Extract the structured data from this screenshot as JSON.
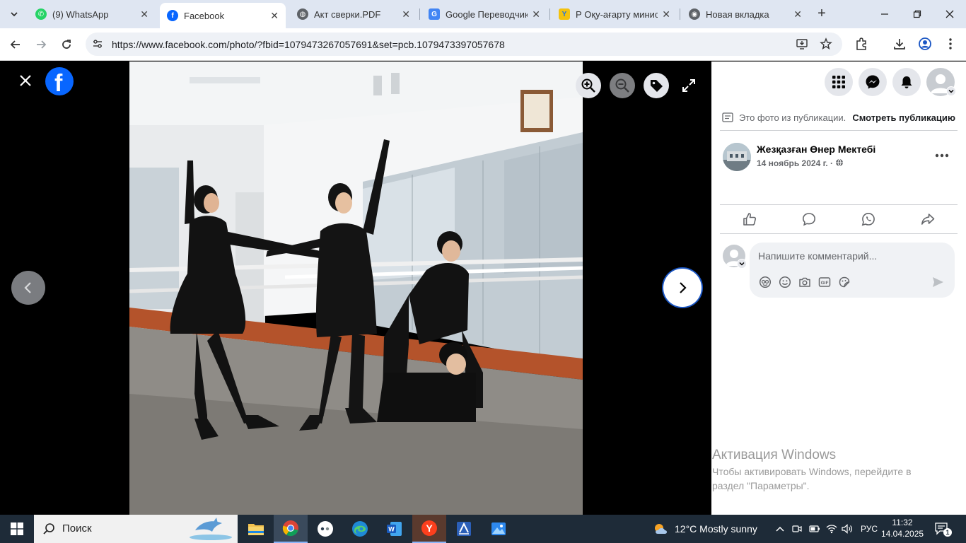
{
  "browser": {
    "tabs": [
      {
        "title": "(9) WhatsApp",
        "favicon": "whatsapp-icon",
        "color": "#25d366"
      },
      {
        "title": "Facebook",
        "favicon": "facebook-icon",
        "color": "#0866ff"
      },
      {
        "title": "Акт сверки.PDF",
        "favicon": "globe-icon",
        "color": "#5f6368"
      },
      {
        "title": "Google Переводчик",
        "favicon": "translate-icon",
        "color": "#4285f4"
      },
      {
        "title": "Р Оқу-ағарту минис",
        "favicon": "ministry-icon",
        "color": "#1a73e8"
      },
      {
        "title": "Новая вкладка",
        "favicon": "chrome-icon",
        "color": "#5f6368"
      }
    ],
    "url": "https://www.facebook.com/photo/?fbid=1079473267057691&set=pcb.1079473397057678"
  },
  "panel": {
    "from_post_text": "Это фото из публикации.",
    "view_post_label": "Смотреть публикацию",
    "author_name": "Жезқазған Өнер Мектебі",
    "post_date": "14 ноябрь 2024 г. ·",
    "comment_placeholder": "Напишите комментарий..."
  },
  "activation": {
    "title": "Активация Windows",
    "message": "Чтобы активировать Windows, перейдите в раздел \"Параметры\"."
  },
  "taskbar": {
    "search_label": "Поиск",
    "weather": "12°C  Mostly sunny",
    "language": "РУС",
    "time": "11:32",
    "date": "14.04.2025",
    "notification_count": "1"
  },
  "colors": {
    "facebook_blue": "#0866ff",
    "taskbar_bg": "#1e2b38",
    "tabstrip_bg": "#dfe6f2"
  }
}
